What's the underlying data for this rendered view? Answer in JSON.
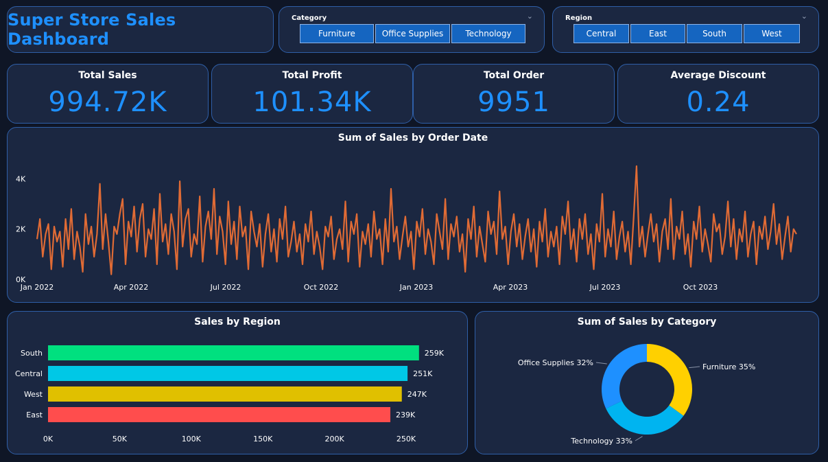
{
  "dashboard": {
    "title": "Super Store Sales Dashboard"
  },
  "filters": {
    "category": {
      "label": "Category",
      "options": [
        "Furniture",
        "Office Supplies",
        "Technology"
      ]
    },
    "region": {
      "label": "Region",
      "options": [
        "Central",
        "East",
        "South",
        "West"
      ]
    }
  },
  "kpis": {
    "total_sales": {
      "label": "Total Sales",
      "value": "994.72K"
    },
    "total_profit": {
      "label": "Total Profit",
      "value": "101.34K"
    },
    "total_order": {
      "label": "Total Order",
      "value": "9951"
    },
    "avg_discount": {
      "label": "Average Discount",
      "value": "0.24"
    }
  },
  "colors": {
    "accent": "#1e90ff",
    "line": "#e06b35",
    "south": "#00e07f",
    "central": "#00c8e6",
    "west": "#e0c000",
    "east": "#ff4d4d",
    "furniture": "#ffd000",
    "technology": "#00b4f0",
    "office_supplies": "#1e90ff"
  },
  "chart_data": [
    {
      "type": "line",
      "title": "Sum of Sales by Order Date",
      "y_ticks": [
        "0K",
        "2K",
        "4K"
      ],
      "ylim": [
        0,
        4500
      ],
      "x_ticks": [
        "Jan 2022",
        "Apr 2022",
        "Jul 2022",
        "Oct 2022",
        "Jan 2023",
        "Apr 2023",
        "Jul 2023",
        "Oct 2023"
      ],
      "x_range": [
        "2022-01-01",
        "2023-12-31"
      ],
      "series": [
        {
          "values": [
            1600,
            2400,
            900,
            1800,
            2200,
            400,
            2100,
            1500,
            1900,
            500,
            2400,
            1200,
            2800,
            800,
            1900,
            1300,
            300,
            2600,
            1400,
            2100,
            900,
            1800,
            3800,
            1200,
            2600,
            1500,
            200,
            2100,
            1800,
            2600,
            3200,
            600,
            2300,
            1700,
            2900,
            1100,
            2400,
            3000,
            900,
            2000,
            1600,
            2800,
            600,
            3400,
            1500,
            2200,
            1000,
            2600,
            1900,
            400,
            3900,
            1300,
            2400,
            2800,
            900,
            1800,
            1400,
            3300,
            700,
            2100,
            2700,
            1600,
            3600,
            1000,
            2500,
            1900,
            600,
            3100,
            1400,
            2300,
            800,
            2900,
            1700,
            2100,
            400,
            2700,
            1900,
            1300,
            2200,
            500,
            1800,
            2600,
            1100,
            2000,
            700,
            2400,
            1600,
            2900,
            900,
            1500,
            2300,
            1100,
            1800,
            600,
            2200,
            1500,
            2700,
            1000,
            1900,
            1300,
            400,
            2100,
            1700,
            2500,
            800,
            1600,
            2000,
            1200,
            3100,
            700,
            2300,
            1800,
            2600,
            500,
            1900,
            1400,
            2200,
            900,
            2700,
            1600,
            2000,
            600,
            2400,
            1100,
            3600,
            1500,
            2100,
            800,
            1700,
            2500,
            1300,
            1900,
            400,
            2300,
            1700,
            2800,
            1000,
            2000,
            1500,
            600,
            2600,
            1900,
            1200,
            3200,
            800,
            2200,
            1700,
            2500,
            1100,
            1800,
            300,
            2400,
            1600,
            2900,
            900,
            2100,
            1400,
            700,
            2700,
            1800,
            2300,
            1000,
            3500,
            1600,
            2100,
            600,
            1900,
            2600,
            1300,
            2200,
            800,
            1700,
            2400,
            1100,
            2000,
            500,
            2300,
            1500,
            2800,
            900,
            1900,
            1300,
            2100,
            600,
            2500,
            1800,
            3100,
            1200,
            2000,
            700,
            2400,
            1600,
            2600,
            1000,
            1800,
            400,
            2200,
            1500,
            3400,
            900,
            2000,
            1300,
            2700,
            800,
            1700,
            2300,
            1100,
            1900,
            600,
            2500,
            4500,
            1300,
            2100,
            900,
            1800,
            2600,
            1500,
            2200,
            700,
            1900,
            2400,
            1200,
            3200,
            800,
            2100,
            1600,
            2700,
            1000,
            1800,
            500,
            2300,
            1600,
            2900,
            1100,
            2000,
            1400,
            700,
            2600,
            1900,
            2200,
            1000,
            1700,
            3100,
            1300,
            2400,
            800,
            2000,
            1500,
            2700,
            900,
            1800,
            2300,
            600,
            2100,
            1600,
            2500,
            1200,
            1900,
            3000,
            1400,
            2200,
            800,
            1700,
            2500,
            1100,
            2000,
            1800
          ]
        }
      ]
    },
    {
      "type": "bar",
      "orientation": "horizontal",
      "title": "Sales by Region",
      "categories": [
        "South",
        "Central",
        "West",
        "East"
      ],
      "values": [
        259,
        251,
        247,
        239
      ],
      "data_labels": [
        "259K",
        "251K",
        "247K",
        "239K"
      ],
      "x_ticks": [
        "0K",
        "50K",
        "100K",
        "150K",
        "200K",
        "250K"
      ],
      "xlim": [
        0,
        250
      ]
    },
    {
      "type": "pie",
      "style": "donut",
      "title": "Sum of Sales by Category",
      "categories": [
        "Furniture",
        "Technology",
        "Office Supplies"
      ],
      "values": [
        35,
        33,
        32
      ],
      "data_labels": [
        "Furniture 35%",
        "Technology 33%",
        "Office Supplies 32%"
      ]
    }
  ]
}
